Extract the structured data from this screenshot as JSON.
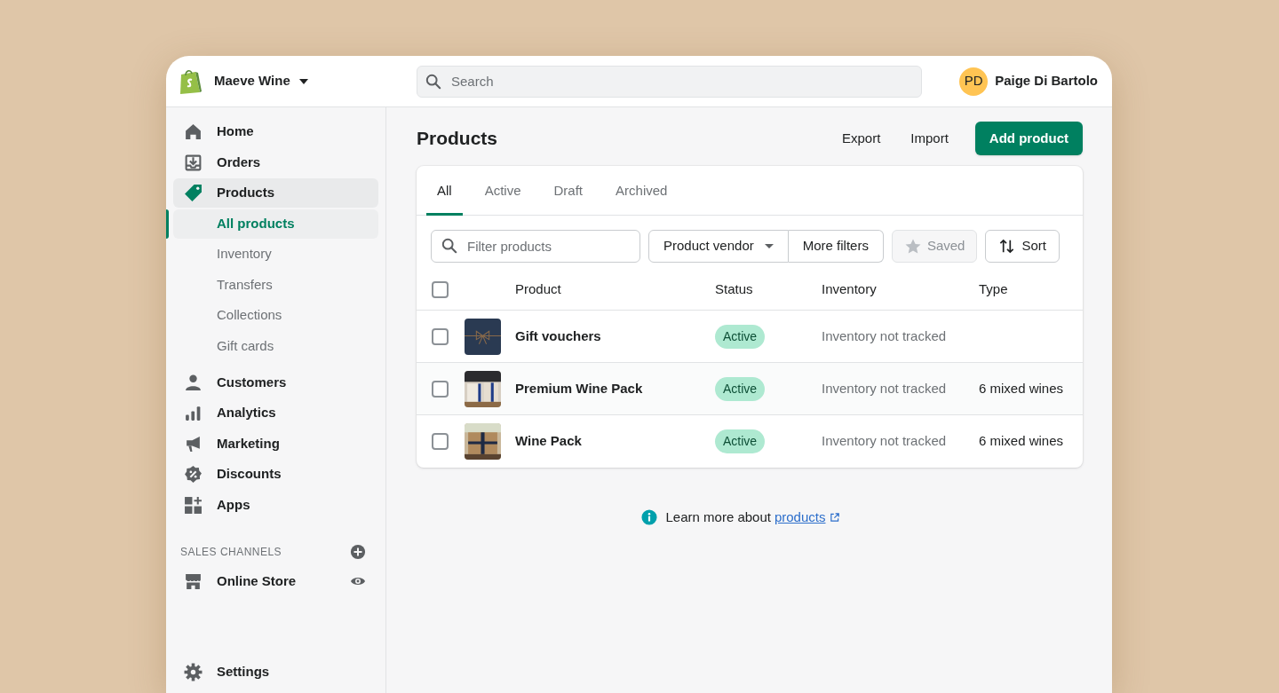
{
  "store": {
    "name": "Maeve Wine"
  },
  "search": {
    "placeholder": "Search"
  },
  "user": {
    "initials": "PD",
    "name": "Paige Di Bartolo"
  },
  "nav": [
    {
      "label": "Home",
      "kind": "home",
      "selected": false
    },
    {
      "label": "Orders",
      "kind": "orders",
      "selected": false
    },
    {
      "label": "Products",
      "kind": "products",
      "selected": true,
      "children": [
        {
          "label": "All products",
          "selected": true
        },
        {
          "label": "Inventory",
          "selected": false
        },
        {
          "label": "Transfers",
          "selected": false
        },
        {
          "label": "Collections",
          "selected": false
        },
        {
          "label": "Gift cards",
          "selected": false
        }
      ]
    },
    {
      "label": "Customers",
      "kind": "customers",
      "selected": false
    },
    {
      "label": "Analytics",
      "kind": "analytics",
      "selected": false
    },
    {
      "label": "Marketing",
      "kind": "marketing",
      "selected": false
    },
    {
      "label": "Discounts",
      "kind": "discounts",
      "selected": false
    },
    {
      "label": "Apps",
      "kind": "apps",
      "selected": false
    }
  ],
  "sales_channels": {
    "title": "SALES CHANNELS",
    "items": [
      {
        "label": "Online Store"
      }
    ]
  },
  "settings": {
    "label": "Settings"
  },
  "page": {
    "title": "Products",
    "actions": [
      "Export",
      "Import"
    ],
    "primary": "Add product"
  },
  "tabs": [
    {
      "label": "All",
      "selected": true
    },
    {
      "label": "Active",
      "selected": false
    },
    {
      "label": "Draft",
      "selected": false
    },
    {
      "label": "Archived",
      "selected": false
    }
  ],
  "filters": {
    "placeholder": "Filter products",
    "vendor": "Product vendor",
    "more": "More filters",
    "saved": {
      "label": "Saved",
      "disabled": true
    },
    "sort": "Sort"
  },
  "table": {
    "select_all": {
      "checked": false
    },
    "columns": [
      "Product",
      "Status",
      "Inventory",
      "Type"
    ],
    "rows": [
      {
        "checked": false,
        "product": "Gift vouchers",
        "status": "Active",
        "inventory": "Inventory not tracked"
      },
      {
        "checked": false,
        "product": "Premium Wine Pack",
        "status": "Active",
        "inventory": "Inventory not tracked",
        "type": "6 mixed wines"
      },
      {
        "checked": false,
        "product": "Wine Pack",
        "status": "Active",
        "inventory": "Inventory not tracked",
        "type": "6 mixed wines"
      }
    ]
  },
  "footer": {
    "text": "Learn more about",
    "link": "products"
  }
}
